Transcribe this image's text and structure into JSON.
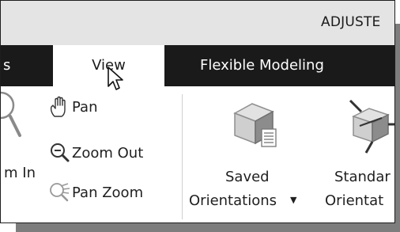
{
  "window": {
    "title": "ADJUSTE"
  },
  "tabs": [
    {
      "label": "s",
      "active": false
    },
    {
      "label": "View",
      "active": true
    },
    {
      "label": "Flexible Modeling",
      "active": false
    }
  ],
  "ribbon": {
    "zoom_in_label": "m In",
    "pan_label": "Pan",
    "zoom_out_label": "Zoom Out",
    "pan_zoom_label": "Pan Zoom",
    "saved_orientations": {
      "line1": "Saved",
      "line2": "Orientations",
      "dropdown": "▼"
    },
    "standard_orientation": {
      "line1": "Standar",
      "line2": "Orientat"
    }
  },
  "colors": {
    "tabbar": "#1a1a1a",
    "titlebar": "#e4e4e4",
    "active_tab": "#ffffff"
  },
  "icons": [
    "magnifier-icon",
    "hand-pan-icon",
    "zoom-out-icon",
    "pan-zoom-icon",
    "saved-orientations-icon",
    "standard-orientation-icon",
    "mouse-cursor-icon"
  ]
}
